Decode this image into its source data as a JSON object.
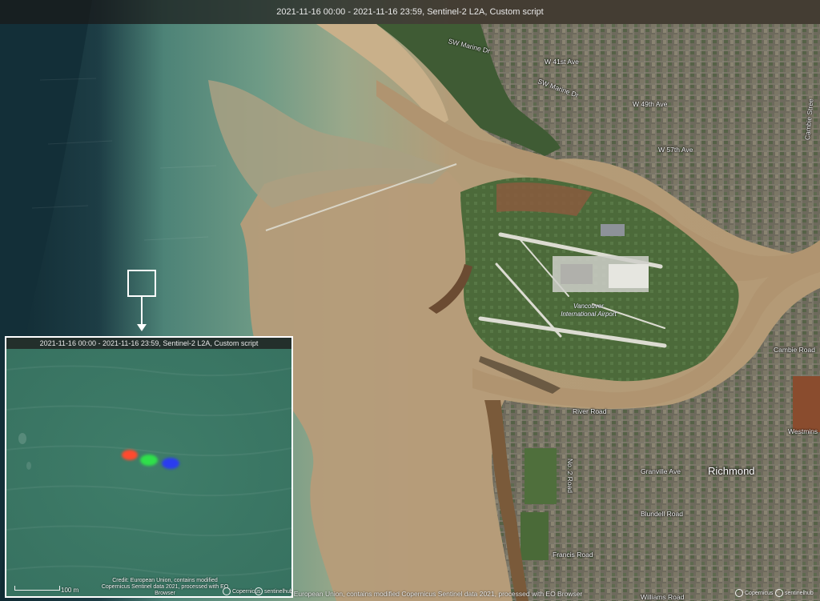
{
  "header": {
    "caption": "2021-11-16 00:00 - 2021-11-16 23:59, Sentinel-2 L2A, Custom script"
  },
  "map": {
    "roads": {
      "sw_marine_1": "SW Marine Dr",
      "sw_marine_2": "SW Marine Dr",
      "w41": "W 41st Ave",
      "w49": "W 49th Ave",
      "w57": "W 57th Ave",
      "cambie_top": "Cambie Stree",
      "cambie_mid": "Cambie Road",
      "river_road": "River Road",
      "granville": "Granville Ave",
      "blundell": "Blundell Road",
      "francis": "Francis Road",
      "williams": "Williams Road",
      "no2": "No. 2 Road",
      "westminster": "Westmins"
    },
    "city": "Richmond",
    "airport": [
      "Vancouver",
      "International Airport"
    ],
    "bottom_credit": ": European Union, contains modified Copernicus Sentinel data 2021, processed with EO Browser"
  },
  "inset": {
    "caption": "2021-11-16 00:00 - 2021-11-16 23:59, Sentinel-2 L2A, Custom script",
    "credit": "Credit: European Union, contains modified Copernicus Sentinel data 2021, processed with EO Browser",
    "scale": "100 m",
    "logo_copernicus": "Copernicus",
    "logo_sentinelhub": "sentinelhub",
    "blobs": [
      "red",
      "green",
      "blue"
    ]
  },
  "logos": {
    "copernicus": "Copernicus",
    "sentinelhub": "sentinelhub"
  },
  "colors": {
    "deep_sea": "#12303a",
    "coastal_water": "#5b8f80",
    "sediment": "#b59c7a",
    "urban": "#6f6a5c",
    "river": "#b09370",
    "runway": "#d8d8d0"
  }
}
